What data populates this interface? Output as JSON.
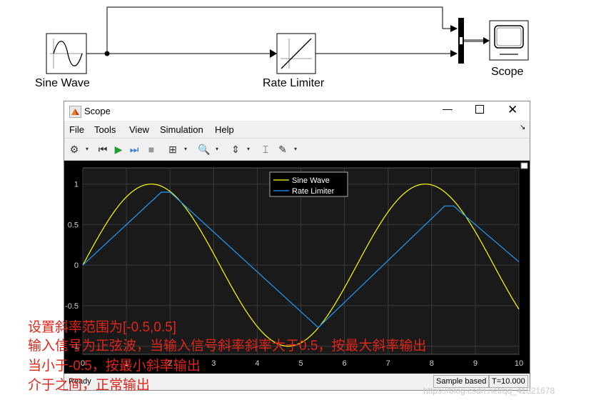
{
  "model": {
    "sine_block_label": "Sine Wave",
    "rate_block_label": "Rate Limiter",
    "scope_block_label": "Scope"
  },
  "window": {
    "title": "Scope",
    "menu": [
      "File",
      "Tools",
      "View",
      "Simulation",
      "Help"
    ],
    "status_left": "Ready",
    "status_sample": "Sample based",
    "status_time": "T=10.000"
  },
  "chart_data": {
    "type": "line",
    "title": "",
    "xlabel": "",
    "ylabel": "",
    "xlim": [
      0,
      10
    ],
    "ylim": [
      -1.1,
      1.2
    ],
    "xticks": [
      "0",
      "1",
      "2",
      "3",
      "4",
      "5",
      "6",
      "7",
      "8",
      "9",
      "10"
    ],
    "yticks": [
      "1",
      "0.5",
      "0",
      "-0.5",
      "-1"
    ],
    "grid": true,
    "legend_position": "top-center",
    "series": [
      {
        "name": "Sine Wave",
        "color": "#ffff00",
        "function": "sin(t)",
        "x_start": 0,
        "x_end": 10
      },
      {
        "name": "Rate Limiter",
        "color": "#1f9bff",
        "x": [
          0,
          1.8,
          2.0,
          5.4,
          8.3,
          8.5,
          10
        ],
        "y": [
          0,
          0.9,
          0.9,
          -0.77,
          0.73,
          0.73,
          0.04
        ]
      }
    ]
  },
  "annotation_lines": [
    "设置斜率范围为[-0.5,0.5]",
    "输入信号为正弦波，当输入信号斜率斜率大于0.5，按最大斜率输出",
    "当小于-0.5，按最小斜率输出",
    "介于之间，正常输出"
  ],
  "watermark": "https://blog.csdn.net/qq_41821678",
  "colors": {
    "plot_bg": "#000000",
    "axes_bg": "#1a1a1a",
    "grid": "#3a3a3a",
    "annotation": "#e0251a"
  }
}
